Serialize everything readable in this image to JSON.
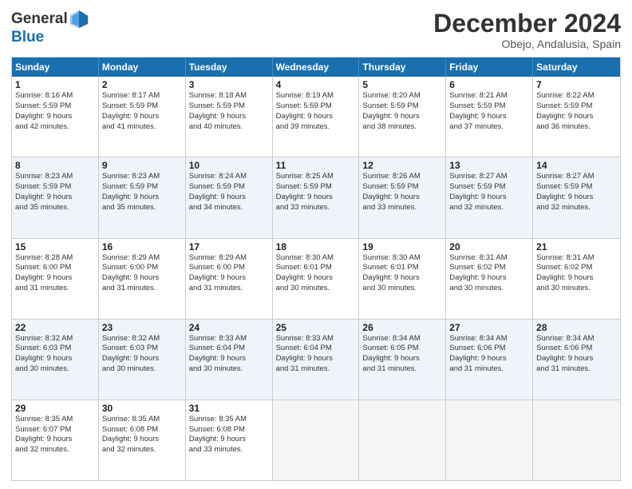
{
  "header": {
    "logo_general": "General",
    "logo_blue": "Blue",
    "month_title": "December 2024",
    "location": "Obejo, Andalusia, Spain"
  },
  "days_of_week": [
    "Sunday",
    "Monday",
    "Tuesday",
    "Wednesday",
    "Thursday",
    "Friday",
    "Saturday"
  ],
  "weeks": [
    {
      "alt": false,
      "cells": [
        {
          "day": "1",
          "lines": [
            "Sunrise: 8:16 AM",
            "Sunset: 5:59 PM",
            "Daylight: 9 hours",
            "and 42 minutes."
          ]
        },
        {
          "day": "2",
          "lines": [
            "Sunrise: 8:17 AM",
            "Sunset: 5:59 PM",
            "Daylight: 9 hours",
            "and 41 minutes."
          ]
        },
        {
          "day": "3",
          "lines": [
            "Sunrise: 8:18 AM",
            "Sunset: 5:59 PM",
            "Daylight: 9 hours",
            "and 40 minutes."
          ]
        },
        {
          "day": "4",
          "lines": [
            "Sunrise: 8:19 AM",
            "Sunset: 5:59 PM",
            "Daylight: 9 hours",
            "and 39 minutes."
          ]
        },
        {
          "day": "5",
          "lines": [
            "Sunrise: 8:20 AM",
            "Sunset: 5:59 PM",
            "Daylight: 9 hours",
            "and 38 minutes."
          ]
        },
        {
          "day": "6",
          "lines": [
            "Sunrise: 8:21 AM",
            "Sunset: 5:59 PM",
            "Daylight: 9 hours",
            "and 37 minutes."
          ]
        },
        {
          "day": "7",
          "lines": [
            "Sunrise: 8:22 AM",
            "Sunset: 5:59 PM",
            "Daylight: 9 hours",
            "and 36 minutes."
          ]
        }
      ]
    },
    {
      "alt": true,
      "cells": [
        {
          "day": "8",
          "lines": [
            "Sunrise: 8:23 AM",
            "Sunset: 5:59 PM",
            "Daylight: 9 hours",
            "and 35 minutes."
          ]
        },
        {
          "day": "9",
          "lines": [
            "Sunrise: 8:23 AM",
            "Sunset: 5:59 PM",
            "Daylight: 9 hours",
            "and 35 minutes."
          ]
        },
        {
          "day": "10",
          "lines": [
            "Sunrise: 8:24 AM",
            "Sunset: 5:59 PM",
            "Daylight: 9 hours",
            "and 34 minutes."
          ]
        },
        {
          "day": "11",
          "lines": [
            "Sunrise: 8:25 AM",
            "Sunset: 5:59 PM",
            "Daylight: 9 hours",
            "and 33 minutes."
          ]
        },
        {
          "day": "12",
          "lines": [
            "Sunrise: 8:26 AM",
            "Sunset: 5:59 PM",
            "Daylight: 9 hours",
            "and 33 minutes."
          ]
        },
        {
          "day": "13",
          "lines": [
            "Sunrise: 8:27 AM",
            "Sunset: 5:59 PM",
            "Daylight: 9 hours",
            "and 32 minutes."
          ]
        },
        {
          "day": "14",
          "lines": [
            "Sunrise: 8:27 AM",
            "Sunset: 5:59 PM",
            "Daylight: 9 hours",
            "and 32 minutes."
          ]
        }
      ]
    },
    {
      "alt": false,
      "cells": [
        {
          "day": "15",
          "lines": [
            "Sunrise: 8:28 AM",
            "Sunset: 6:00 PM",
            "Daylight: 9 hours",
            "and 31 minutes."
          ]
        },
        {
          "day": "16",
          "lines": [
            "Sunrise: 8:29 AM",
            "Sunset: 6:00 PM",
            "Daylight: 9 hours",
            "and 31 minutes."
          ]
        },
        {
          "day": "17",
          "lines": [
            "Sunrise: 8:29 AM",
            "Sunset: 6:00 PM",
            "Daylight: 9 hours",
            "and 31 minutes."
          ]
        },
        {
          "day": "18",
          "lines": [
            "Sunrise: 8:30 AM",
            "Sunset: 6:01 PM",
            "Daylight: 9 hours",
            "and 30 minutes."
          ]
        },
        {
          "day": "19",
          "lines": [
            "Sunrise: 8:30 AM",
            "Sunset: 6:01 PM",
            "Daylight: 9 hours",
            "and 30 minutes."
          ]
        },
        {
          "day": "20",
          "lines": [
            "Sunrise: 8:31 AM",
            "Sunset: 6:02 PM",
            "Daylight: 9 hours",
            "and 30 minutes."
          ]
        },
        {
          "day": "21",
          "lines": [
            "Sunrise: 8:31 AM",
            "Sunset: 6:02 PM",
            "Daylight: 9 hours",
            "and 30 minutes."
          ]
        }
      ]
    },
    {
      "alt": true,
      "cells": [
        {
          "day": "22",
          "lines": [
            "Sunrise: 8:32 AM",
            "Sunset: 6:03 PM",
            "Daylight: 9 hours",
            "and 30 minutes."
          ]
        },
        {
          "day": "23",
          "lines": [
            "Sunrise: 8:32 AM",
            "Sunset: 6:03 PM",
            "Daylight: 9 hours",
            "and 30 minutes."
          ]
        },
        {
          "day": "24",
          "lines": [
            "Sunrise: 8:33 AM",
            "Sunset: 6:04 PM",
            "Daylight: 9 hours",
            "and 30 minutes."
          ]
        },
        {
          "day": "25",
          "lines": [
            "Sunrise: 8:33 AM",
            "Sunset: 6:04 PM",
            "Daylight: 9 hours",
            "and 31 minutes."
          ]
        },
        {
          "day": "26",
          "lines": [
            "Sunrise: 8:34 AM",
            "Sunset: 6:05 PM",
            "Daylight: 9 hours",
            "and 31 minutes."
          ]
        },
        {
          "day": "27",
          "lines": [
            "Sunrise: 8:34 AM",
            "Sunset: 6:06 PM",
            "Daylight: 9 hours",
            "and 31 minutes."
          ]
        },
        {
          "day": "28",
          "lines": [
            "Sunrise: 8:34 AM",
            "Sunset: 6:06 PM",
            "Daylight: 9 hours",
            "and 31 minutes."
          ]
        }
      ]
    },
    {
      "alt": false,
      "cells": [
        {
          "day": "29",
          "lines": [
            "Sunrise: 8:35 AM",
            "Sunset: 6:07 PM",
            "Daylight: 9 hours",
            "and 32 minutes."
          ]
        },
        {
          "day": "30",
          "lines": [
            "Sunrise: 8:35 AM",
            "Sunset: 6:08 PM",
            "Daylight: 9 hours",
            "and 32 minutes."
          ]
        },
        {
          "day": "31",
          "lines": [
            "Sunrise: 8:35 AM",
            "Sunset: 6:08 PM",
            "Daylight: 9 hours",
            "and 33 minutes."
          ]
        },
        {
          "day": "",
          "lines": []
        },
        {
          "day": "",
          "lines": []
        },
        {
          "day": "",
          "lines": []
        },
        {
          "day": "",
          "lines": []
        }
      ]
    }
  ]
}
